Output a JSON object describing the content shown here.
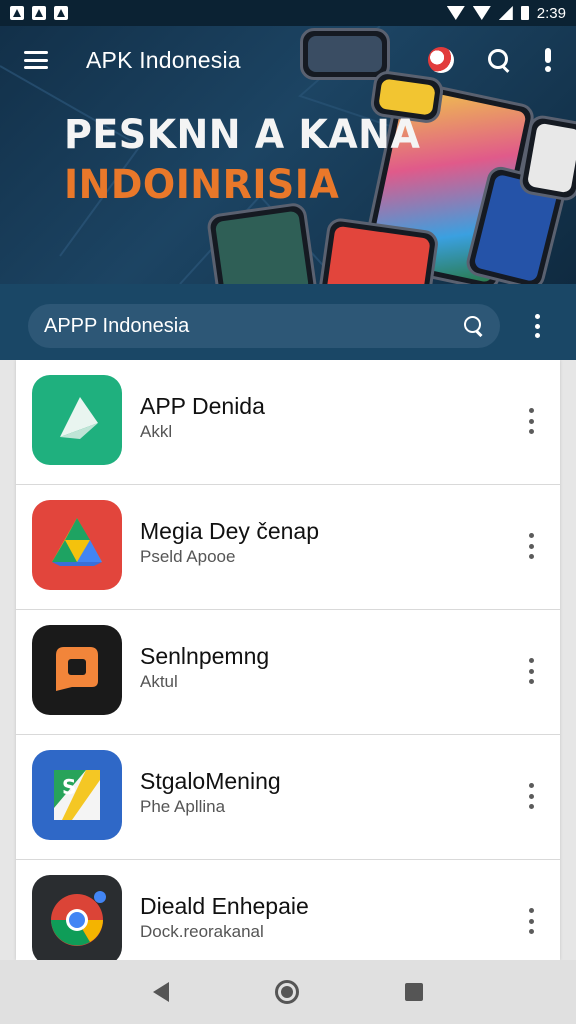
{
  "status_bar": {
    "time": "2:39"
  },
  "toolbar": {
    "title": "APK Indonesia"
  },
  "banner": {
    "line1": "PESKNN A KANA",
    "line2": "INDOINRISIA"
  },
  "search": {
    "value": "APPP Indonesia"
  },
  "apps": [
    {
      "title": "APP Denida",
      "subtitle": "Akkl",
      "icon": "paper-fold-icon",
      "color": "#1fb07e"
    },
    {
      "title": "Megia Dey čenap",
      "subtitle": "Pseld Apooe",
      "icon": "drive-triangle-icon",
      "color": "#e2453c"
    },
    {
      "title": "Senlnpemng",
      "subtitle": "Aktul",
      "icon": "orange-a-icon",
      "color": "#1a1a1a"
    },
    {
      "title": "StgaloMening",
      "subtitle": "Phe Apllina",
      "icon": "map-s-icon",
      "color": "#2f68c7"
    },
    {
      "title": "Dieald Enhepaie",
      "subtitle": "Dock.reorakanal",
      "icon": "chrome-icon",
      "color": "#2a2d30"
    }
  ]
}
